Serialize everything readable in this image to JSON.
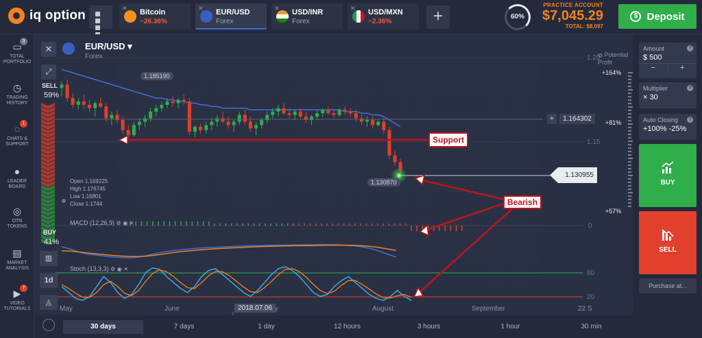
{
  "app": {
    "brand": "iq option"
  },
  "tabs": [
    {
      "name": "Bitcoin",
      "sub": "−26.36%",
      "neg": true,
      "icon_color": "#f7931a"
    },
    {
      "name": "EUR/USD",
      "sub": "Forex",
      "neg": false,
      "active": true,
      "icon_color": "#3a5fc4"
    },
    {
      "name": "USD/INR",
      "sub": "Forex",
      "neg": false,
      "icon_color": "#ff9933"
    },
    {
      "name": "USD/MXN",
      "sub": "−2.36%",
      "neg": true,
      "icon_color": "#1f9d55"
    }
  ],
  "header": {
    "gauge": "60%",
    "account_label": "PRACTICE ACCOUNT",
    "balance": "$7,045.29",
    "total": "TOTAL: $8,097",
    "deposit": "Deposit"
  },
  "sidebar": [
    {
      "label": "TOTAL\nPORTFOLIO",
      "icon": "portfolio-icon",
      "badge": "3",
      "badge_gray": true
    },
    {
      "label": "TRADING\nHISTORY",
      "icon": "history-icon"
    },
    {
      "label": "CHATS &\nSUPPORT",
      "icon": "chat-icon",
      "badge": "1"
    },
    {
      "label": "LEADER\nBOARD",
      "icon": "leaderboard-icon"
    },
    {
      "label": "OTN\nTOKENS",
      "icon": "token-icon"
    },
    {
      "label": "MARKET\nANALYSIS",
      "icon": "market-analysis-icon"
    },
    {
      "label": "VIDEO\nTUTORIALS",
      "icon": "video-icon",
      "badge": "7"
    }
  ],
  "chart_header": {
    "pair": "EUR/USD",
    "category": "Forex"
  },
  "sentiment": {
    "sell_label": "SELL",
    "sell_pct": "59%",
    "buy_label": "BUY",
    "buy_pct": "41%"
  },
  "ohlc": {
    "open": "Open  1.169225",
    "high": "High  1.176745",
    "low": "Low   1.16801",
    "close": "Close  1.1744"
  },
  "indicators": {
    "macd": "MACD (12,26,9)",
    "stoch": "Stoch (13,3,3)"
  },
  "annotations": {
    "support": "Support",
    "bearish": "Bearish"
  },
  "prices": {
    "high_marker": "1.185190",
    "low_marker": "1.130870",
    "hline": "1.164302",
    "current": "1.130955",
    "strike": "+"
  },
  "profit": {
    "title": "Potential\nProfit",
    "p1": "+164%",
    "p2": "+81%",
    "p3": "+57%"
  },
  "chart_tools": {
    "timeframe": "1d"
  },
  "chart_data": {
    "type": "candlestick",
    "y_ticks": [
      "1.20",
      "1.15",
      "0",
      "80",
      "20"
    ],
    "x_labels": [
      "May",
      "June",
      "July",
      "August",
      "September"
    ],
    "crosshair_date": "2018.07.06",
    "crosshair_x_suffix": "22 S",
    "ylim": [
      1.125,
      1.2
    ],
    "candles": [
      [
        1.182,
        1.186,
        1.177,
        1.184
      ],
      [
        1.184,
        1.187,
        1.174,
        1.176
      ],
      [
        1.176,
        1.179,
        1.17,
        1.172
      ],
      [
        1.172,
        1.176,
        1.169,
        1.174
      ],
      [
        1.174,
        1.178,
        1.17,
        1.172
      ],
      [
        1.172,
        1.175,
        1.168,
        1.17
      ],
      [
        1.17,
        1.174,
        1.165,
        1.173
      ],
      [
        1.173,
        1.176,
        1.17,
        1.171
      ],
      [
        1.171,
        1.173,
        1.162,
        1.164
      ],
      [
        1.164,
        1.168,
        1.16,
        1.166
      ],
      [
        1.166,
        1.169,
        1.161,
        1.163
      ],
      [
        1.163,
        1.165,
        1.155,
        1.157
      ],
      [
        1.157,
        1.16,
        1.152,
        1.154
      ],
      [
        1.154,
        1.162,
        1.153,
        1.16
      ],
      [
        1.16,
        1.164,
        1.157,
        1.162
      ],
      [
        1.162,
        1.166,
        1.159,
        1.164
      ],
      [
        1.164,
        1.17,
        1.162,
        1.168
      ],
      [
        1.168,
        1.172,
        1.165,
        1.17
      ],
      [
        1.17,
        1.174,
        1.168,
        1.172
      ],
      [
        1.172,
        1.176,
        1.17,
        1.174
      ],
      [
        1.174,
        1.177,
        1.171,
        1.173
      ],
      [
        1.173,
        1.176,
        1.17,
        1.175
      ],
      [
        1.175,
        1.178,
        1.172,
        1.174
      ],
      [
        1.174,
        1.176,
        1.154,
        1.156
      ],
      [
        1.156,
        1.16,
        1.153,
        1.159
      ],
      [
        1.159,
        1.161,
        1.155,
        1.157
      ],
      [
        1.157,
        1.162,
        1.155,
        1.16
      ],
      [
        1.16,
        1.164,
        1.157,
        1.162
      ],
      [
        1.162,
        1.166,
        1.159,
        1.164
      ],
      [
        1.164,
        1.168,
        1.161,
        1.162
      ],
      [
        1.162,
        1.165,
        1.158,
        1.16
      ],
      [
        1.16,
        1.163,
        1.156,
        1.162
      ],
      [
        1.162,
        1.168,
        1.16,
        1.166
      ],
      [
        1.166,
        1.169,
        1.16,
        1.162
      ],
      [
        1.162,
        1.165,
        1.156,
        1.158
      ],
      [
        1.158,
        1.162,
        1.154,
        1.16
      ],
      [
        1.16,
        1.164,
        1.158,
        1.163
      ],
      [
        1.163,
        1.168,
        1.161,
        1.166
      ],
      [
        1.166,
        1.17,
        1.164,
        1.168
      ],
      [
        1.168,
        1.172,
        1.165,
        1.17
      ],
      [
        1.17,
        1.173,
        1.166,
        1.167
      ],
      [
        1.167,
        1.17,
        1.164,
        1.166
      ],
      [
        1.166,
        1.169,
        1.163,
        1.168
      ],
      [
        1.168,
        1.17,
        1.164,
        1.165
      ],
      [
        1.165,
        1.168,
        1.161,
        1.163
      ],
      [
        1.163,
        1.166,
        1.16,
        1.165
      ],
      [
        1.165,
        1.169,
        1.163,
        1.167
      ],
      [
        1.167,
        1.17,
        1.165,
        1.169
      ],
      [
        1.169,
        1.171,
        1.166,
        1.167
      ],
      [
        1.167,
        1.169,
        1.164,
        1.166
      ],
      [
        1.166,
        1.17,
        1.165,
        1.169
      ],
      [
        1.169,
        1.171,
        1.166,
        1.168
      ],
      [
        1.168,
        1.17,
        1.165,
        1.167
      ],
      [
        1.167,
        1.169,
        1.162,
        1.164
      ],
      [
        1.164,
        1.166,
        1.16,
        1.162
      ],
      [
        1.162,
        1.165,
        1.159,
        1.163
      ],
      [
        1.163,
        1.165,
        1.158,
        1.16
      ],
      [
        1.16,
        1.163,
        1.159,
        1.162
      ],
      [
        1.162,
        1.164,
        1.155,
        1.157
      ],
      [
        1.157,
        1.159,
        1.14,
        1.142
      ],
      [
        1.142,
        1.145,
        1.136,
        1.138
      ],
      [
        1.138,
        1.14,
        1.131,
        1.133
      ]
    ],
    "ma": [
      1.193,
      1.192,
      1.191,
      1.19,
      1.189,
      1.188,
      1.187,
      1.186,
      1.185,
      1.184,
      1.183,
      1.182,
      1.181,
      1.18,
      1.179,
      1.178,
      1.177,
      1.176,
      1.176,
      1.175,
      1.175,
      1.174,
      1.174,
      1.173,
      1.173,
      1.172,
      1.172,
      1.171,
      1.171,
      1.17,
      1.17,
      1.17,
      1.17,
      1.17,
      1.169,
      1.169,
      1.169,
      1.169,
      1.169,
      1.169,
      1.169,
      1.169,
      1.169,
      1.169,
      1.169,
      1.169,
      1.169,
      1.169,
      1.169,
      1.169,
      1.169,
      1.168,
      1.168,
      1.168,
      1.167,
      1.167,
      1.166,
      1.166,
      1.165,
      1.163,
      1.161,
      1.159
    ],
    "macd_line": [
      0.8,
      0.7,
      0.55,
      0.45,
      0.4,
      0.35,
      0.3,
      0.28,
      0.26,
      0.3,
      0.38,
      0.48,
      0.56,
      0.62,
      0.66,
      0.7,
      0.74,
      0.76,
      0.78,
      0.8,
      0.82,
      0.84,
      0.85,
      0.86,
      0.87,
      0.88,
      0.88,
      0.89,
      0.9,
      0.9,
      0.91,
      0.91,
      0.9,
      0.88,
      0.85,
      0.8,
      0.72,
      0.6,
      0.45,
      0.3
    ],
    "macd_signal": [
      0.6,
      0.6,
      0.55,
      0.5,
      0.46,
      0.42,
      0.38,
      0.35,
      0.33,
      0.33,
      0.35,
      0.4,
      0.46,
      0.52,
      0.57,
      0.61,
      0.65,
      0.68,
      0.71,
      0.73,
      0.75,
      0.77,
      0.79,
      0.81,
      0.82,
      0.83,
      0.84,
      0.85,
      0.86,
      0.86,
      0.87,
      0.88,
      0.88,
      0.88,
      0.87,
      0.85,
      0.82,
      0.77,
      0.7,
      0.62
    ],
    "stoch_k": [
      45,
      30,
      15,
      10,
      20,
      45,
      70,
      55,
      30,
      15,
      25,
      50,
      80,
      92,
      88,
      70,
      55,
      40,
      30,
      45,
      70,
      85,
      90,
      75,
      60,
      45,
      30,
      20,
      35,
      55,
      75,
      90,
      95,
      85,
      70,
      50,
      30,
      20,
      25,
      45,
      60,
      70,
      55,
      40,
      25,
      15,
      10,
      20,
      35,
      20,
      10
    ],
    "stoch_d": [
      50,
      40,
      28,
      18,
      18,
      30,
      50,
      58,
      45,
      28,
      22,
      35,
      58,
      78,
      87,
      82,
      70,
      55,
      42,
      40,
      55,
      72,
      83,
      82,
      72,
      58,
      44,
      32,
      30,
      42,
      58,
      75,
      88,
      90,
      82,
      68,
      50,
      35,
      27,
      33,
      48,
      60,
      60,
      50,
      38,
      26,
      17,
      16,
      22,
      25,
      18
    ]
  },
  "timeframes": [
    "30 days",
    "7 days",
    "1 day",
    "12 hours",
    "3 hours",
    "1 hour",
    "30 min"
  ],
  "panel": {
    "amount_label": "Amount",
    "amount_value": "$  500",
    "minus": "−",
    "plus": "+",
    "multiplier_label": "Multiplier",
    "multiplier_value": "× 30",
    "auto_label": "Auto Closing",
    "auto_value": "+100%  -25%",
    "buy": "BUY",
    "sell": "SELL",
    "purchase": "Purchase at..."
  },
  "colors": {
    "bull": "#2fae4a",
    "bear": "#e0402c",
    "accent": "#f58220",
    "ma": "#3d6fd9",
    "annot": "#c0141b"
  }
}
